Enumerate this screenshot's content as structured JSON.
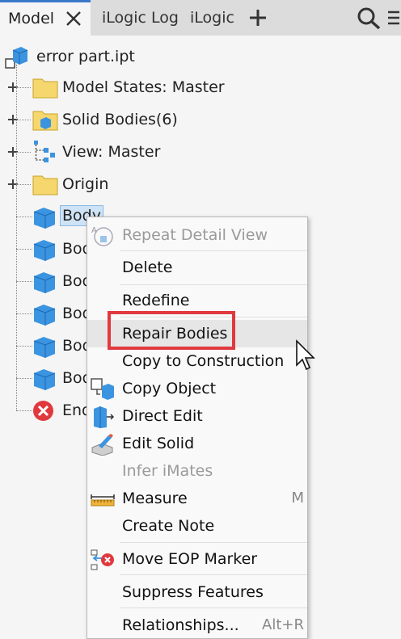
{
  "tabs": {
    "model": "Model",
    "ilogic_log": "iLogic Log",
    "ilogic": "iLogic"
  },
  "tree": {
    "root": "error part.ipt",
    "items": [
      {
        "label": "Model States: Master"
      },
      {
        "label": "Solid Bodies(6)"
      },
      {
        "label": "View: Master"
      },
      {
        "label": "Origin"
      }
    ],
    "bodies": [
      "Body",
      "Bod",
      "Bod",
      "Bod",
      "Bod",
      "Bod"
    ],
    "end_item": "End"
  },
  "context_menu": {
    "items": [
      {
        "label": "Repeat Detail View",
        "enabled": false,
        "underline": "R"
      },
      {
        "label": "Delete",
        "enabled": true,
        "underline": "D"
      },
      {
        "label": "Redefine",
        "enabled": true,
        "underline": "R"
      },
      {
        "label": "Repair Bodies",
        "enabled": true,
        "highlighted": true
      },
      {
        "label": "Copy to Construction",
        "enabled": true
      },
      {
        "label": "Copy Object",
        "enabled": true
      },
      {
        "label": "Direct Edit",
        "enabled": true
      },
      {
        "label": "Edit Solid",
        "enabled": true
      },
      {
        "label": "Infer iMates",
        "enabled": false
      },
      {
        "label": "Measure",
        "enabled": true,
        "shortcut": "M",
        "underline": "M"
      },
      {
        "label": "Create Note",
        "enabled": true,
        "underline": "C"
      },
      {
        "label": "Move EOP Marker",
        "enabled": true,
        "underline": "E"
      },
      {
        "label": "Suppress Features",
        "enabled": true
      },
      {
        "label": "Relationships...",
        "enabled": true,
        "shortcut": "Alt+R"
      }
    ]
  },
  "colors": {
    "accent": "#3a78c9",
    "highlight_box": "#e0393e",
    "folder": "#f5d76e",
    "body_cube": "#3b94e0",
    "error": "#e0393e"
  }
}
